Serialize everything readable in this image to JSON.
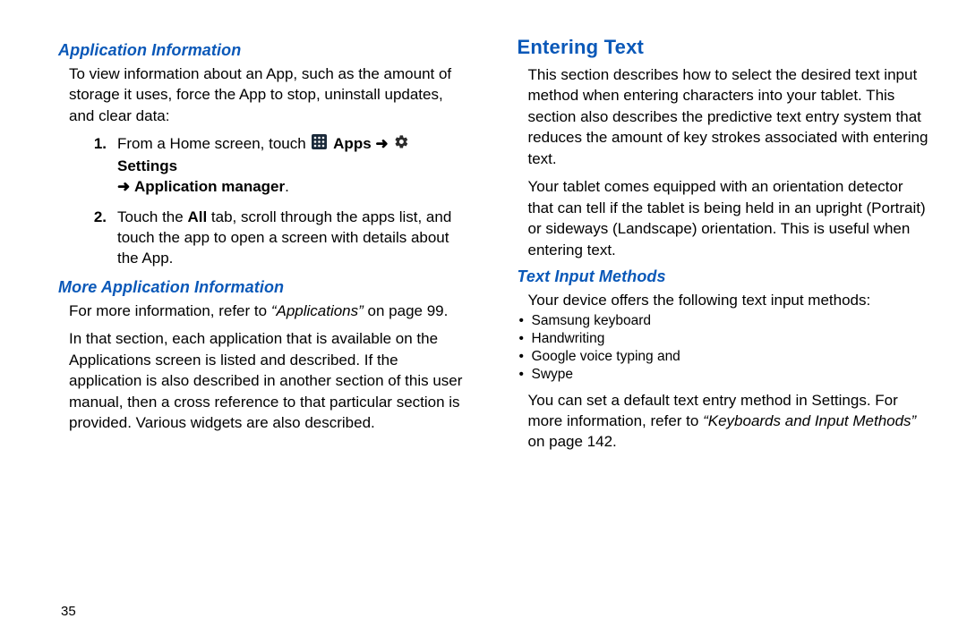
{
  "page_number": "35",
  "left": {
    "sub1_title": "Application Information",
    "sub1_para": "To view information about an App, such as the amount of storage it uses, force the App to stop, uninstall updates, and clear data:",
    "step1_prefix": "From a Home screen, touch ",
    "step1_apps": "Apps",
    "step1_settings": "Settings",
    "step1_appmgr": "Application manager",
    "step2_a": "Touch the ",
    "step2_all": "All",
    "step2_b": " tab, scroll through the apps list, and touch the app to open a screen with details about the App.",
    "sub2_title": "More Application Information",
    "sub2_p1a": "For more information, refer to ",
    "sub2_p1q": "“Applications”",
    "sub2_p1b": " on page 99.",
    "sub2_p2": "In that section, each application that is available on the Applications screen is listed and described. If the application is also described in another section of this user manual, then a cross reference to that particular section is provided. Various widgets are also described."
  },
  "right": {
    "h2": "Entering Text",
    "p1": "This section describes how to select the desired text input method when entering characters into your tablet. This section also describes the predictive text entry system that reduces the amount of key strokes associated with entering text.",
    "p2": "Your tablet comes equipped with an orientation detector that can tell if the tablet is being held in an upright (Portrait) or sideways (Landscape) orientation. This is useful when entering text.",
    "sub1_title": "Text Input Methods",
    "sub1_intro": "Your device offers the following text input methods:",
    "bullets": [
      "Samsung keyboard",
      "Handwriting",
      "Google voice typing and",
      "Swype"
    ],
    "sub1_p2a": "You can set a default text entry method in Settings. For more information, refer to ",
    "sub1_p2q": "“Keyboards and Input Methods”",
    "sub1_p2b": " on page 142."
  },
  "step_nums": [
    "1.",
    "2."
  ],
  "arrows": {
    "right": "➜"
  }
}
